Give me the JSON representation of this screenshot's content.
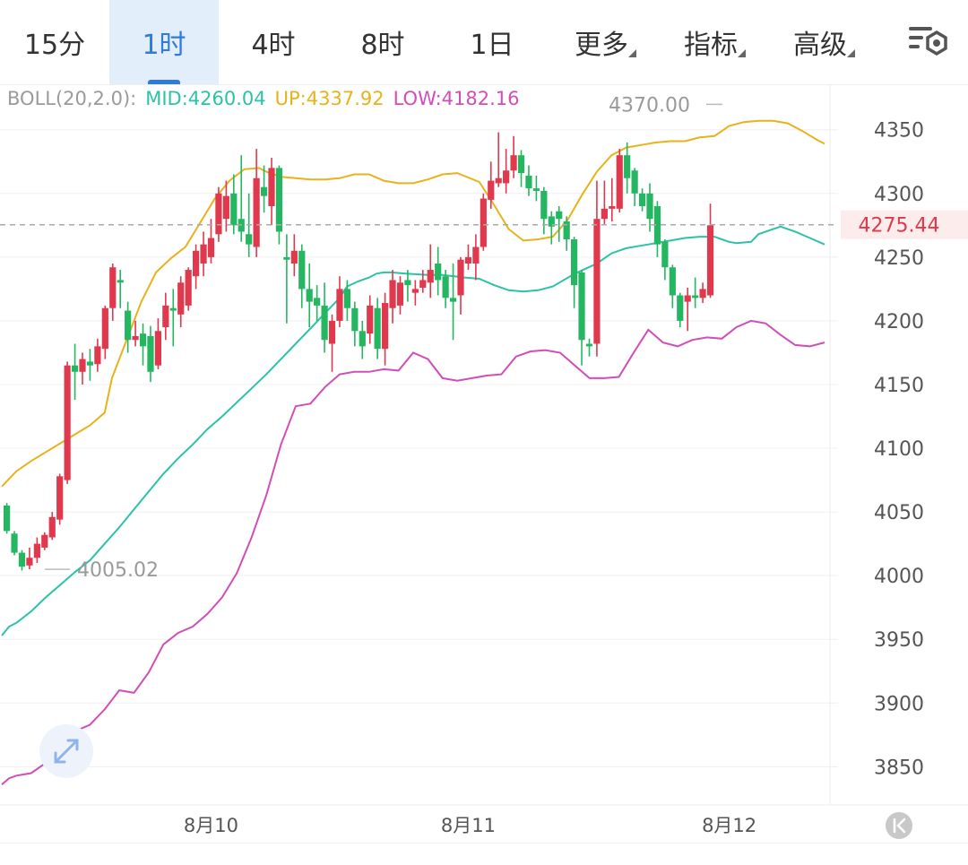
{
  "tabs": [
    {
      "label": "15分",
      "active": false,
      "dropdown": false
    },
    {
      "label": "1时",
      "active": true,
      "dropdown": false
    },
    {
      "label": "4时",
      "active": false,
      "dropdown": false
    },
    {
      "label": "8时",
      "active": false,
      "dropdown": false
    },
    {
      "label": "1日",
      "active": false,
      "dropdown": false
    },
    {
      "label": "更多",
      "active": false,
      "dropdown": true
    },
    {
      "label": "指标",
      "active": false,
      "dropdown": true
    },
    {
      "label": "高级",
      "active": false,
      "dropdown": true
    }
  ],
  "settings_icon": "chart-settings-icon",
  "boll": {
    "label": "BOLL(20,2.0):",
    "mid": "MID:4260.04",
    "up": "UP:4337.92",
    "low": "LOW:4182.16"
  },
  "colors": {
    "up_candle": "#e0384c",
    "down_candle": "#25b661",
    "mid": "#2cc2a6",
    "upper": "#e8b21a",
    "lower": "#d24db8",
    "price_tag": "#e0384c",
    "active_tab": "#2f7bdc"
  },
  "chart_data": {
    "type": "candlestick",
    "ylim": [
      3820,
      4385
    ],
    "y_ticks": [
      "4350",
      "4300",
      "4250",
      "4200",
      "4150",
      "4100",
      "4050",
      "4000",
      "3950",
      "3900",
      "3850"
    ],
    "x_ticks": [
      "8月10",
      "8月11",
      "8月12"
    ],
    "current_price": "4275.44",
    "high_label": "4370.00",
    "low_label": "4005.02",
    "grid": true,
    "candles": [
      [
        4055,
        4057,
        4035,
        4033
      ],
      [
        4033,
        4035,
        4018,
        4016
      ],
      [
        4018,
        4020,
        4007,
        4004
      ],
      [
        4008,
        4022,
        4014,
        4005
      ],
      [
        4014,
        4030,
        4025,
        4010
      ],
      [
        4022,
        4034,
        4032,
        4020
      ],
      [
        4030,
        4050,
        4046,
        4028
      ],
      [
        4044,
        4080,
        4078,
        4040
      ],
      [
        4075,
        4168,
        4165,
        4072
      ],
      [
        4165,
        4182,
        4160,
        4138
      ],
      [
        4160,
        4175,
        4170,
        4150
      ],
      [
        4168,
        4178,
        4165,
        4153
      ],
      [
        4166,
        4186,
        4180,
        4160
      ],
      [
        4178,
        4212,
        4210,
        4170
      ],
      [
        4210,
        4245,
        4242,
        4200
      ],
      [
        4232,
        4240,
        4230,
        4210
      ],
      [
        4208,
        4215,
        4185,
        4175
      ],
      [
        4185,
        4200,
        4188,
        4180
      ],
      [
        4190,
        4198,
        4180,
        4165
      ],
      [
        4188,
        4196,
        4160,
        4152
      ],
      [
        4165,
        4202,
        4192,
        4162
      ],
      [
        4195,
        4222,
        4212,
        4185
      ],
      [
        4210,
        4225,
        4208,
        4180
      ],
      [
        4205,
        4235,
        4230,
        4195
      ],
      [
        4212,
        4242,
        4240,
        4208
      ],
      [
        4235,
        4260,
        4255,
        4225
      ],
      [
        4245,
        4270,
        4260,
        4235
      ],
      [
        4250,
        4280,
        4265,
        4245
      ],
      [
        4268,
        4305,
        4300,
        4262
      ],
      [
        4280,
        4310,
        4298,
        4270
      ],
      [
        4300,
        4315,
        4275,
        4268
      ],
      [
        4280,
        4330,
        4270,
        4262
      ],
      [
        4268,
        4300,
        4260,
        4250
      ],
      [
        4258,
        4335,
        4312,
        4250
      ],
      [
        4305,
        4322,
        4298,
        4285
      ],
      [
        4290,
        4328,
        4320,
        4275
      ],
      [
        4320,
        4322,
        4270,
        4260
      ],
      [
        4250,
        4268,
        4248,
        4198
      ],
      [
        4245,
        4268,
        4255,
        4235
      ],
      [
        4255,
        4260,
        4225,
        4210
      ],
      [
        4225,
        4245,
        4215,
        4195
      ],
      [
        4218,
        4228,
        4212,
        4200
      ],
      [
        4212,
        4230,
        4185,
        4175
      ],
      [
        4182,
        4205,
        4200,
        4160
      ],
      [
        4200,
        4235,
        4225,
        4195
      ],
      [
        4225,
        4232,
        4210,
        4200
      ],
      [
        4210,
        4215,
        4192,
        4180
      ],
      [
        4192,
        4200,
        4180,
        4170
      ],
      [
        4190,
        4220,
        4212,
        4182
      ],
      [
        4210,
        4218,
        4178,
        4170
      ],
      [
        4178,
        4222,
        4214,
        4165
      ],
      [
        4210,
        4240,
        4232,
        4198
      ],
      [
        4212,
        4235,
        4230,
        4205
      ],
      [
        4232,
        4240,
        4228,
        4215
      ],
      [
        4222,
        4232,
        4225,
        4212
      ],
      [
        4226,
        4240,
        4232,
        4222
      ],
      [
        4230,
        4260,
        4240,
        4218
      ],
      [
        4245,
        4258,
        4232,
        4220
      ],
      [
        4235,
        4240,
        4218,
        4210
      ],
      [
        4218,
        4245,
        4215,
        4185
      ],
      [
        4220,
        4250,
        4248,
        4205
      ],
      [
        4245,
        4260,
        4250,
        4240
      ],
      [
        4245,
        4268,
        4258,
        4232
      ],
      [
        4258,
        4300,
        4296,
        4255
      ],
      [
        4295,
        4325,
        4310,
        4288
      ],
      [
        4308,
        4348,
        4312,
        4305
      ],
      [
        4308,
        4335,
        4318,
        4300
      ],
      [
        4318,
        4345,
        4330,
        4312
      ],
      [
        4330,
        4334,
        4316,
        4305
      ],
      [
        4314,
        4322,
        4304,
        4298
      ],
      [
        4304,
        4314,
        4302,
        4294
      ],
      [
        4302,
        4305,
        4280,
        4268
      ],
      [
        4282,
        4286,
        4274,
        4260
      ],
      [
        4286,
        4290,
        4280,
        4262
      ],
      [
        4278,
        4282,
        4264,
        4255
      ],
      [
        4264,
        4266,
        4228,
        4210
      ],
      [
        4238,
        4240,
        4185,
        4165
      ],
      [
        4182,
        4186,
        4180,
        4172
      ],
      [
        4182,
        4310,
        4280,
        4172
      ],
      [
        4280,
        4310,
        4288,
        4276
      ],
      [
        4288,
        4312,
        4290,
        4278
      ],
      [
        4288,
        4335,
        4330,
        4285
      ],
      [
        4330,
        4340,
        4312,
        4300
      ],
      [
        4318,
        4320,
        4300,
        4290
      ],
      [
        4300,
        4304,
        4290,
        4286
      ],
      [
        4300,
        4308,
        4280,
        4270
      ],
      [
        4290,
        4294,
        4260,
        4250
      ],
      [
        4262,
        4264,
        4242,
        4232
      ],
      [
        4242,
        4244,
        4220,
        4210
      ],
      [
        4220,
        4222,
        4200,
        4195
      ],
      [
        4215,
        4226,
        4220,
        4192
      ],
      [
        4220,
        4234,
        4218,
        4210
      ],
      [
        4218,
        4230,
        4225,
        4214
      ],
      [
        4220,
        4292,
        4275,
        4218
      ]
    ],
    "mid": [
      [
        0,
        3953
      ],
      [
        2,
        3960
      ],
      [
        4,
        3963
      ],
      [
        8,
        3972
      ],
      [
        12,
        3983
      ],
      [
        16,
        3993
      ],
      [
        20,
        4003
      ],
      [
        24,
        4012
      ],
      [
        28,
        4025
      ],
      [
        32,
        4038
      ],
      [
        36,
        4052
      ],
      [
        40,
        4066
      ],
      [
        44,
        4080
      ],
      [
        48,
        4092
      ],
      [
        52,
        4103
      ],
      [
        56,
        4115
      ],
      [
        60,
        4125
      ],
      [
        64,
        4136
      ],
      [
        68,
        4147
      ],
      [
        72,
        4158
      ],
      [
        76,
        4170
      ],
      [
        80,
        4182
      ],
      [
        84,
        4194
      ],
      [
        88,
        4206
      ],
      [
        92,
        4218
      ],
      [
        94,
        4227
      ],
      [
        97,
        4231
      ],
      [
        100,
        4234
      ],
      [
        102,
        4237
      ],
      [
        104,
        4238
      ],
      [
        106,
        4238
      ],
      [
        110,
        4237
      ],
      [
        116,
        4236
      ],
      [
        120,
        4236
      ],
      [
        126,
        4234
      ],
      [
        130,
        4233
      ],
      [
        134,
        4228
      ],
      [
        138,
        4224
      ],
      [
        142,
        4223
      ],
      [
        146,
        4224
      ],
      [
        150,
        4227
      ],
      [
        156,
        4237
      ],
      [
        162,
        4245
      ],
      [
        166,
        4253
      ],
      [
        170,
        4257
      ],
      [
        176,
        4260
      ],
      [
        182,
        4263
      ],
      [
        186,
        4265
      ],
      [
        190,
        4266
      ],
      [
        194,
        4266
      ],
      [
        196,
        4264
      ],
      [
        198,
        4262
      ],
      [
        200,
        4261
      ],
      [
        204,
        4262
      ],
      [
        206,
        4268
      ],
      [
        210,
        4272
      ],
      [
        212,
        4274
      ],
      [
        216,
        4270
      ],
      [
        220,
        4265
      ],
      [
        224,
        4260
      ]
    ],
    "upper": [
      [
        0,
        4070
      ],
      [
        2,
        4076
      ],
      [
        4,
        4082
      ],
      [
        8,
        4090
      ],
      [
        12,
        4097
      ],
      [
        16,
        4104
      ],
      [
        20,
        4111
      ],
      [
        24,
        4118
      ],
      [
        28,
        4128
      ],
      [
        30,
        4155
      ],
      [
        34,
        4185
      ],
      [
        38,
        4215
      ],
      [
        42,
        4238
      ],
      [
        46,
        4249
      ],
      [
        50,
        4258
      ],
      [
        54,
        4277
      ],
      [
        58,
        4296
      ],
      [
        62,
        4310
      ],
      [
        66,
        4319
      ],
      [
        70,
        4320
      ],
      [
        72,
        4317
      ],
      [
        76,
        4313
      ],
      [
        80,
        4312
      ],
      [
        84,
        4311
      ],
      [
        88,
        4311
      ],
      [
        92,
        4312
      ],
      [
        96,
        4315
      ],
      [
        100,
        4315
      ],
      [
        104,
        4310
      ],
      [
        108,
        4308
      ],
      [
        112,
        4308
      ],
      [
        116,
        4311
      ],
      [
        120,
        4315
      ],
      [
        124,
        4316
      ],
      [
        130,
        4309
      ],
      [
        134,
        4291
      ],
      [
        138,
        4272
      ],
      [
        142,
        4263
      ],
      [
        146,
        4264
      ],
      [
        150,
        4266
      ],
      [
        154,
        4279
      ],
      [
        158,
        4299
      ],
      [
        162,
        4317
      ],
      [
        166,
        4330
      ],
      [
        170,
        4336
      ],
      [
        174,
        4338
      ],
      [
        178,
        4340
      ],
      [
        182,
        4341
      ],
      [
        186,
        4341
      ],
      [
        190,
        4344
      ],
      [
        194,
        4345
      ],
      [
        196,
        4349
      ],
      [
        198,
        4353
      ],
      [
        202,
        4356
      ],
      [
        206,
        4357
      ],
      [
        210,
        4357
      ],
      [
        214,
        4355
      ],
      [
        218,
        4349
      ],
      [
        222,
        4342
      ],
      [
        224,
        4339
      ]
    ],
    "lower": [
      [
        0,
        3836
      ],
      [
        2,
        3841
      ],
      [
        4,
        3843
      ],
      [
        8,
        3845
      ],
      [
        12,
        3853
      ],
      [
        16,
        3865
      ],
      [
        20,
        3878
      ],
      [
        24,
        3883
      ],
      [
        28,
        3895
      ],
      [
        32,
        3910
      ],
      [
        36,
        3908
      ],
      [
        40,
        3924
      ],
      [
        44,
        3946
      ],
      [
        48,
        3955
      ],
      [
        52,
        3960
      ],
      [
        56,
        3970
      ],
      [
        60,
        3983
      ],
      [
        64,
        4002
      ],
      [
        68,
        4030
      ],
      [
        72,
        4063
      ],
      [
        76,
        4103
      ],
      [
        80,
        4133
      ],
      [
        84,
        4135
      ],
      [
        88,
        4148
      ],
      [
        92,
        4158
      ],
      [
        96,
        4160
      ],
      [
        100,
        4160
      ],
      [
        104,
        4162
      ],
      [
        108,
        4161
      ],
      [
        112,
        4175
      ],
      [
        116,
        4170
      ],
      [
        120,
        4155
      ],
      [
        124,
        4153
      ],
      [
        128,
        4155
      ],
      [
        132,
        4157
      ],
      [
        136,
        4158
      ],
      [
        140,
        4172
      ],
      [
        144,
        4176
      ],
      [
        148,
        4177
      ],
      [
        152,
        4175
      ],
      [
        156,
        4165
      ],
      [
        160,
        4155
      ],
      [
        164,
        4155
      ],
      [
        168,
        4156
      ],
      [
        172,
        4175
      ],
      [
        176,
        4193
      ],
      [
        180,
        4183
      ],
      [
        184,
        4180
      ],
      [
        188,
        4185
      ],
      [
        192,
        4187
      ],
      [
        196,
        4186
      ],
      [
        200,
        4195
      ],
      [
        204,
        4200
      ],
      [
        208,
        4198
      ],
      [
        212,
        4189
      ],
      [
        216,
        4181
      ],
      [
        220,
        4180
      ],
      [
        224,
        4183
      ]
    ]
  }
}
